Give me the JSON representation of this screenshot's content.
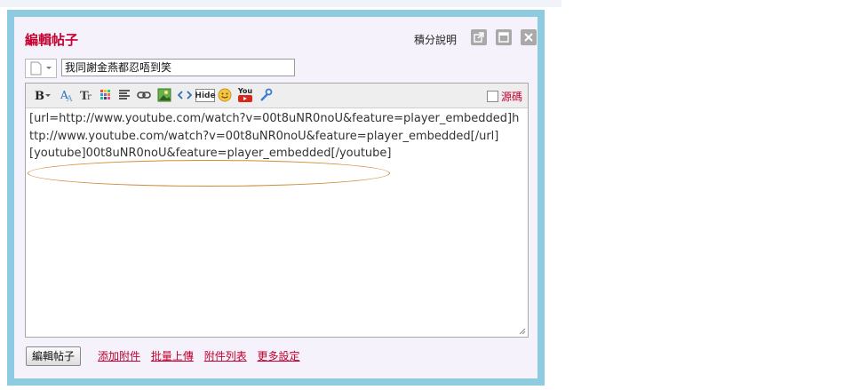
{
  "dialog": {
    "title": "編輯帖子",
    "header_link": "積分說明",
    "header_icons": [
      "popout-icon",
      "maximize-icon",
      "close-icon"
    ]
  },
  "subject": {
    "value": "我同謝金燕都忍唔到笑"
  },
  "editor": {
    "toolbar": [
      "bold-icon",
      "font-color-icon",
      "font-size-icon",
      "background-color-icon",
      "align-icon",
      "link-icon",
      "image-icon",
      "code-icon",
      "hide-icon",
      "smiley-icon",
      "youtube-icon",
      "settings-icon"
    ],
    "hide_label": "Hide",
    "youtube_label": "You",
    "source_label": "源碼",
    "content": "[url=http://www.youtube.com/watch?v=00t8uNR0noU&feature=player_embedded]http://www.youtube.com/watch?v=00t8uNR0noU&feature=player_embedded[/url]\n[youtube]00t8uNR0noU&feature=player_embedded[/youtube]"
  },
  "footer": {
    "submit_label": "編輯帖子",
    "links": [
      "添加附件",
      "批量上傳",
      "附件列表",
      "更多設定"
    ]
  },
  "colors": {
    "accent": "#c3002f",
    "frame": "#8ecae0",
    "annotation": "#d08a3a"
  }
}
